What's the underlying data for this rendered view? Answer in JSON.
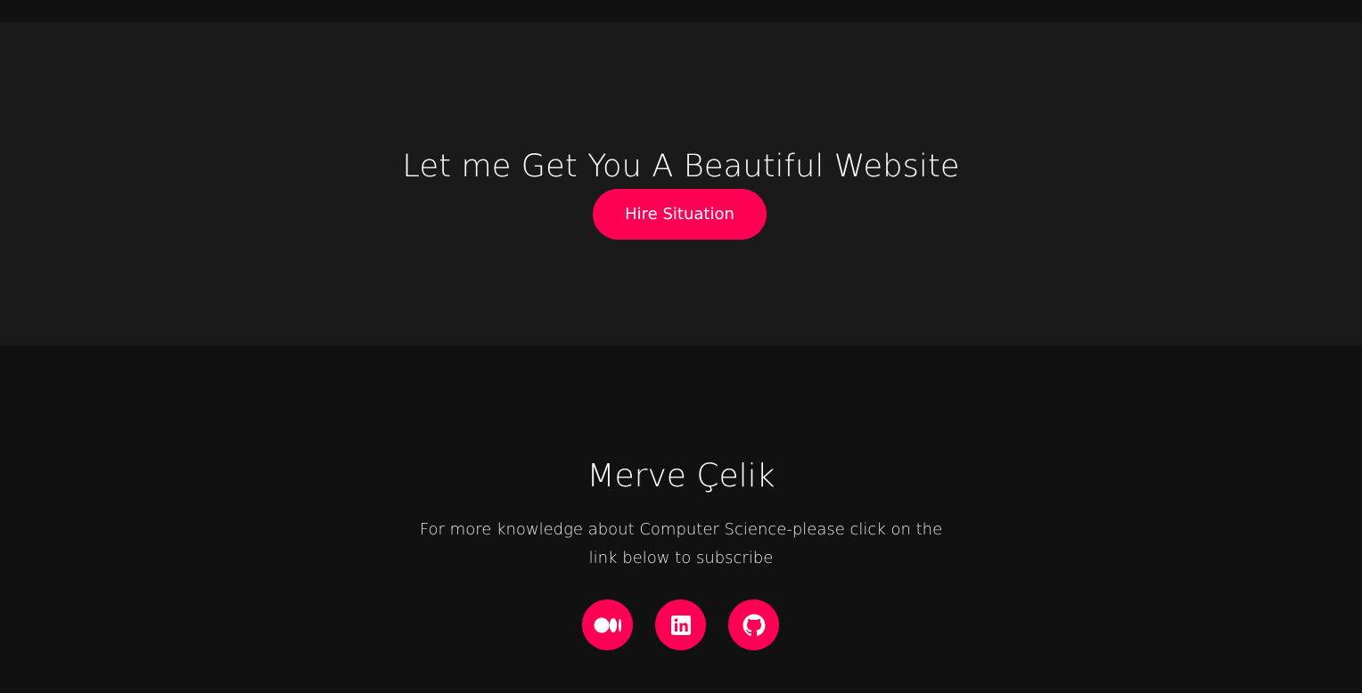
{
  "colors": {
    "accent": "#ff0055",
    "cta_background": "#1a1a1a",
    "footer_background": "#111111",
    "text": "#ffffff"
  },
  "cta": {
    "title": "Let me Get You A Beautiful Website",
    "button_label": "Hire Situation"
  },
  "footer": {
    "name": "Merve Çelik",
    "description": "For more knowledge about Computer Science-please click on the link below to subscribe",
    "social_links": [
      {
        "icon": "medium-icon"
      },
      {
        "icon": "linkedin-icon"
      },
      {
        "icon": "github-icon"
      }
    ]
  }
}
